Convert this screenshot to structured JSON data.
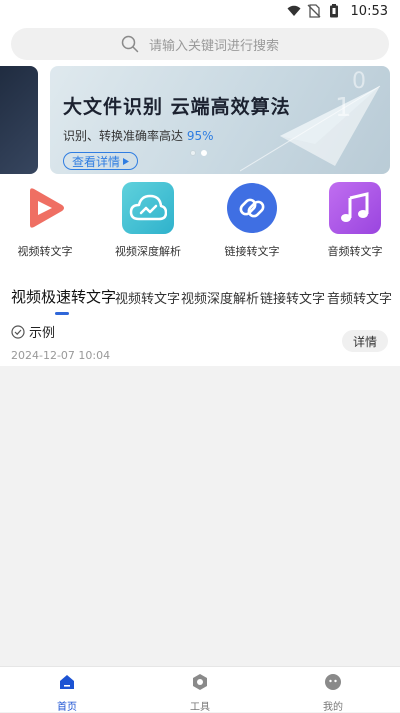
{
  "status_bar": {
    "time": "10:53"
  },
  "search": {
    "placeholder": "请输入关键词进行搜索"
  },
  "banner": {
    "headline": "大文件识别 云端高效算法",
    "subtitle_prefix": "识别、转换准确率高达 ",
    "subtitle_percent": "95%",
    "cta_label": "查看详情",
    "deco_number_a": "0",
    "deco_number_b": "1"
  },
  "tools": [
    {
      "label": "视频转文字",
      "icon": "play-icon",
      "color": "#ef6f63"
    },
    {
      "label": "视频深度解析",
      "icon": "cloud-icon",
      "color": "#39bfd3"
    },
    {
      "label": "链接转文字",
      "icon": "link-icon",
      "color": "#3f6fe3"
    },
    {
      "label": "音频转文字",
      "icon": "music-note-icon",
      "color": "#b35be6"
    }
  ],
  "tabs": [
    "视频极速转文字",
    "视频转文字",
    "视频深度解析",
    "链接转文字",
    "音频转文字"
  ],
  "example": {
    "title": "示例",
    "date": "2024-12-07 10:04",
    "detail_label": "详情"
  },
  "bottom_nav": [
    {
      "label": "首页",
      "icon": "home-icon",
      "active": true
    },
    {
      "label": "工具",
      "icon": "tool-icon",
      "active": false
    },
    {
      "label": "我的",
      "icon": "profile-icon",
      "active": false
    }
  ],
  "colors": {
    "accent": "#2f7de1",
    "nav_active": "#1c53d3"
  }
}
